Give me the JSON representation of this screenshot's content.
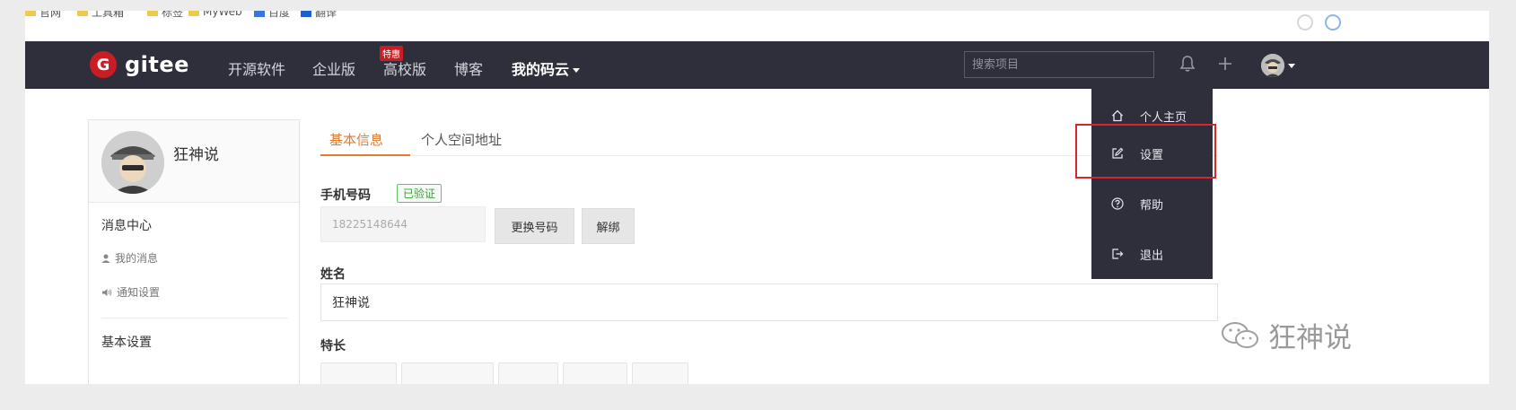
{
  "bookmarks": [
    {
      "label": "官网",
      "icon": "folder-icon"
    },
    {
      "label": "工具箱",
      "icon": "folder-icon"
    },
    {
      "label": "标签",
      "icon": "folder-icon"
    },
    {
      "label": "MyWeb",
      "icon": "folder-icon"
    },
    {
      "label": "百度",
      "icon": "web-icon"
    },
    {
      "label": "翻译",
      "icon": "web-icon"
    }
  ],
  "navbar": {
    "logo_mark": "G",
    "logo_text": "gitee",
    "items": [
      {
        "label": "开源软件"
      },
      {
        "label": "企业版"
      },
      {
        "label": "高校版"
      },
      {
        "label": "博客"
      },
      {
        "label": "我的码云"
      }
    ],
    "badge_hot": "特惠",
    "search_placeholder": "搜索项目",
    "icons": [
      "bell-icon",
      "plus-icon",
      "avatar-icon",
      "chevron-down-icon"
    ]
  },
  "sidebar": {
    "user_name": "狂神说",
    "sections": [
      {
        "title": "消息中心",
        "links": [
          {
            "label": "我的消息",
            "icon": "user-icon"
          },
          {
            "label": "通知设置",
            "icon": "speaker-icon"
          }
        ]
      },
      {
        "title": "基本设置",
        "links": []
      }
    ]
  },
  "main": {
    "tabs": [
      {
        "label": "基本信息",
        "active": true
      },
      {
        "label": "个人空间地址",
        "active": false
      }
    ],
    "phone": {
      "label": "手机号码",
      "verified_badge": "已验证",
      "value": "18225148644",
      "change_button": "更换号码",
      "unbind_button": "解绑"
    },
    "name": {
      "label": "姓名",
      "value": "狂神说"
    },
    "skills": {
      "label": "特长"
    }
  },
  "dropdown": {
    "items": [
      {
        "label": "个人主页",
        "icon": "home-icon"
      },
      {
        "label": "设置",
        "icon": "edit-icon"
      },
      {
        "label": "帮助",
        "icon": "help-icon"
      },
      {
        "label": "退出",
        "icon": "logout-icon"
      }
    ],
    "highlight_color": "#d8262e"
  },
  "watermark": {
    "text": "狂神说",
    "icon": "wechat-icon"
  },
  "colors": {
    "nav_bg": "#2e2f3a",
    "brand_red": "#c71d23",
    "accent_orange": "#e07b32",
    "verified_green": "#3c9e3c"
  }
}
